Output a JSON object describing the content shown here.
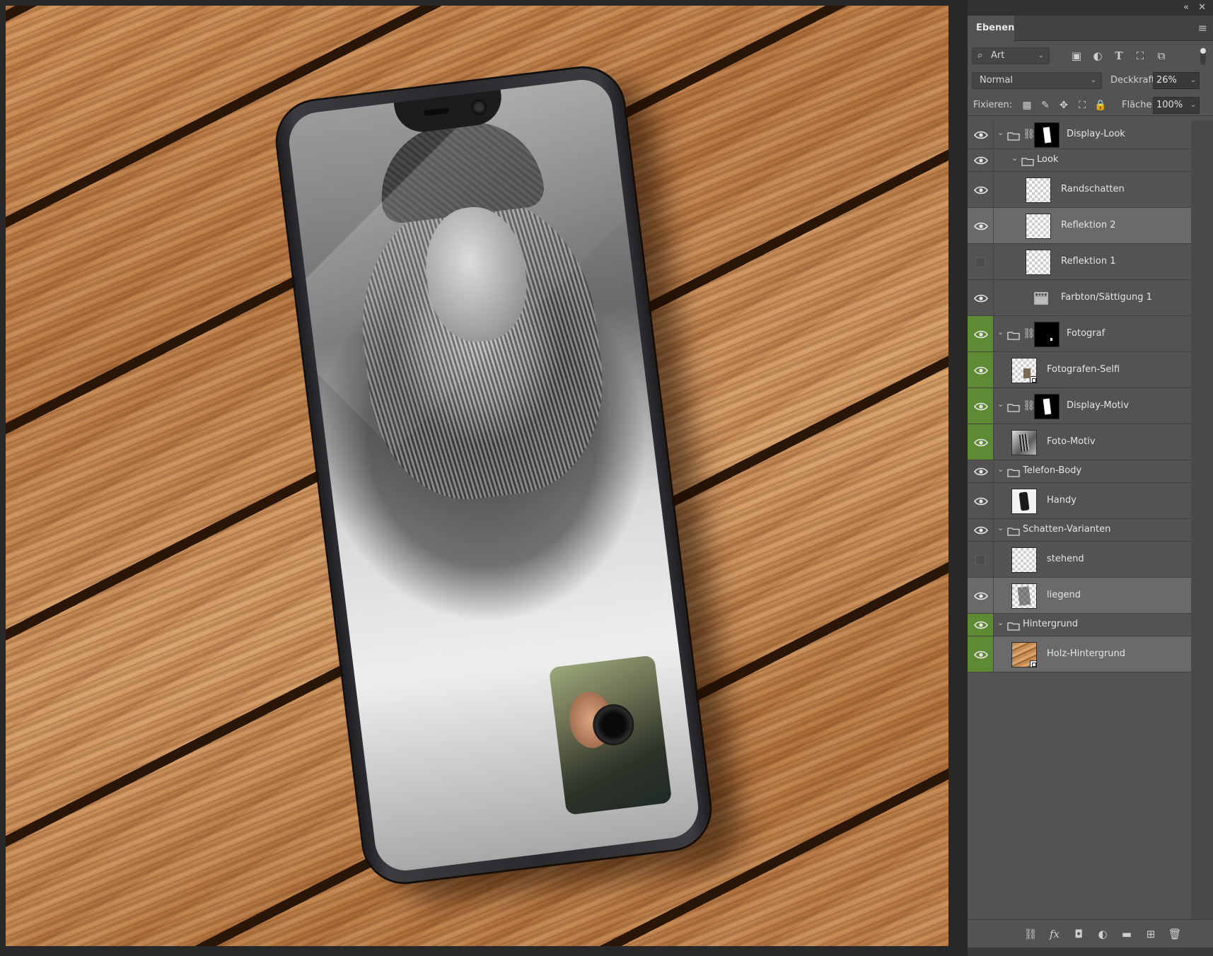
{
  "panel": {
    "title": "Ebenen",
    "topbar": {
      "collapse_icon": "double-chevron-icon",
      "close_icon": "close-icon",
      "collapse_glyph": "«",
      "close_glyph": "✕"
    },
    "menu_glyph": "≡"
  },
  "filter": {
    "kind_label": "Art",
    "icons": [
      "image-filter-icon",
      "adjustment-filter-icon",
      "type-filter-icon",
      "shape-filter-icon",
      "smartobject-filter-icon"
    ]
  },
  "blend": {
    "mode": "Normal",
    "opacity_label": "Deckkraft:",
    "opacity_value": "26%"
  },
  "lock": {
    "label": "Fixieren:",
    "icons": [
      "lock-transparent-icon",
      "lock-image-icon",
      "lock-position-icon",
      "lock-artboard-icon",
      "lock-all-icon"
    ],
    "fill_label": "Fläche:",
    "fill_value": "100%"
  },
  "layers": [
    {
      "name": "Display-Look",
      "kind": "group",
      "visible": true,
      "expanded": true,
      "level": 0,
      "mask": "mask-white",
      "selected": false,
      "green": false
    },
    {
      "name": "Look",
      "kind": "group",
      "visible": true,
      "expanded": true,
      "level": 1,
      "selected": false,
      "green": false
    },
    {
      "name": "Randschatten",
      "kind": "layer",
      "thumb": "trans",
      "visible": true,
      "level": 2,
      "selected": false,
      "green": false
    },
    {
      "name": "Reflektion 2",
      "kind": "layer",
      "thumb": "trans",
      "visible": true,
      "level": 2,
      "selected": true,
      "green": false
    },
    {
      "name": "Reflektion 1",
      "kind": "layer",
      "thumb": "trans",
      "visible": false,
      "level": 2,
      "selected": false,
      "green": false
    },
    {
      "name": "Farbton/Sättigung 1",
      "kind": "adjustment",
      "visible": true,
      "level": 2,
      "selected": false,
      "green": false
    },
    {
      "name": "Fotograf",
      "kind": "group",
      "visible": true,
      "expanded": true,
      "level": 0,
      "mask": "mask-black",
      "selected": false,
      "green": true
    },
    {
      "name": "Fotografen-Selfi",
      "kind": "layer",
      "thumb": "selfie",
      "smart": true,
      "visible": true,
      "level": 1,
      "selected": false,
      "green": true
    },
    {
      "name": "Display-Motiv",
      "kind": "group",
      "visible": true,
      "expanded": true,
      "level": 0,
      "mask": "mask-white",
      "selected": false,
      "green": true
    },
    {
      "name": "Foto-Motiv",
      "kind": "layer",
      "thumb": "photo",
      "visible": true,
      "level": 1,
      "selected": false,
      "green": true
    },
    {
      "name": "Telefon-Body",
      "kind": "group",
      "visible": true,
      "expanded": true,
      "level": 0,
      "selected": false,
      "green": false
    },
    {
      "name": "Handy",
      "kind": "layer",
      "thumb": "phone",
      "visible": true,
      "level": 1,
      "selected": false,
      "green": false
    },
    {
      "name": "Schatten-Varianten",
      "kind": "group",
      "visible": true,
      "expanded": true,
      "level": 0,
      "selected": false,
      "green": false
    },
    {
      "name": "stehend",
      "kind": "layer",
      "thumb": "trans",
      "visible": false,
      "level": 1,
      "selected": false,
      "green": false
    },
    {
      "name": "liegend",
      "kind": "layer",
      "thumb": "shadow",
      "visible": true,
      "level": 1,
      "selected": true,
      "green": false
    },
    {
      "name": "Hintergrund",
      "kind": "group",
      "visible": true,
      "expanded": true,
      "level": 0,
      "selected": false,
      "green": true
    },
    {
      "name": "Holz-Hintergrund",
      "kind": "layer",
      "thumb": "wood",
      "smart": true,
      "visible": true,
      "level": 1,
      "selected": true,
      "green": true
    }
  ],
  "footer": {
    "icons": [
      "link-layers-icon",
      "fx-icon",
      "add-mask-icon",
      "new-adjustment-icon",
      "new-group-icon",
      "new-layer-icon",
      "delete-icon"
    ],
    "glyphs": [
      "⛓",
      "fx",
      "◘",
      "◐",
      "▬",
      "⊞",
      "🗑"
    ]
  },
  "colors": {
    "panel_bg": "#535353",
    "selected_bg": "#6a6a6a",
    "color_label_green": "#5e8a34",
    "canvas_wood": "#c98a52"
  }
}
